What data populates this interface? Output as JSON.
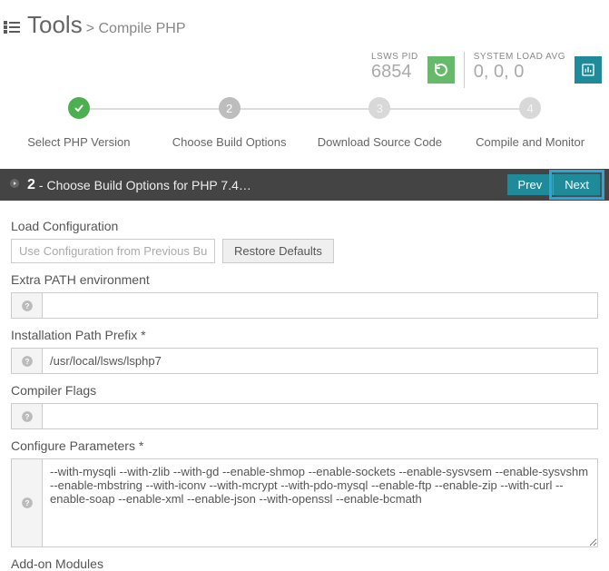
{
  "header": {
    "title": "Tools",
    "crumb_prefix": "> ",
    "crumb": "Compile PHP"
  },
  "status": {
    "pid_label": "LSWS PID",
    "pid_value": "6854",
    "load_label": "SYSTEM LOAD AVG",
    "load_value": "0, 0, 0"
  },
  "steps": [
    {
      "num": "",
      "label": "Select PHP Version",
      "state": "done",
      "check": true
    },
    {
      "num": "2",
      "label": "Choose Build Options",
      "state": "active"
    },
    {
      "num": "3",
      "label": "Download Source Code",
      "state": "pending"
    },
    {
      "num": "4",
      "label": "Compile and Monitor",
      "state": "pending"
    }
  ],
  "panel": {
    "step_num": "2",
    "title": "- Choose Build Options for PHP 7.4…",
    "prev": "Prev",
    "next": "Next"
  },
  "form": {
    "load_config_label": "Load Configuration",
    "load_config_placeholder": "Use Configuration from Previous Build",
    "restore_btn": "Restore Defaults",
    "extra_path_label": "Extra PATH environment",
    "extra_path_value": "",
    "install_prefix_label": "Installation Path Prefix *",
    "install_prefix_value": "/usr/local/lsws/lsphp7",
    "compiler_flags_label": "Compiler Flags",
    "compiler_flags_value": "",
    "configure_params_label": "Configure Parameters *",
    "configure_params_value": "--with-mysqli --with-zlib --with-gd --enable-shmop --enable-sockets --enable-sysvsem --enable-sysvshm --enable-mbstring --with-iconv --with-mcrypt --with-pdo-mysql --enable-ftp --enable-zip --with-curl --enable-soap --enable-xml --enable-json --with-openssl --enable-bcmath",
    "addon_label": "Add-on Modules"
  },
  "icons": {
    "refresh": "refresh-icon",
    "chart": "chart-icon",
    "help": "help-icon",
    "list": "list-icon",
    "check": "✓"
  }
}
